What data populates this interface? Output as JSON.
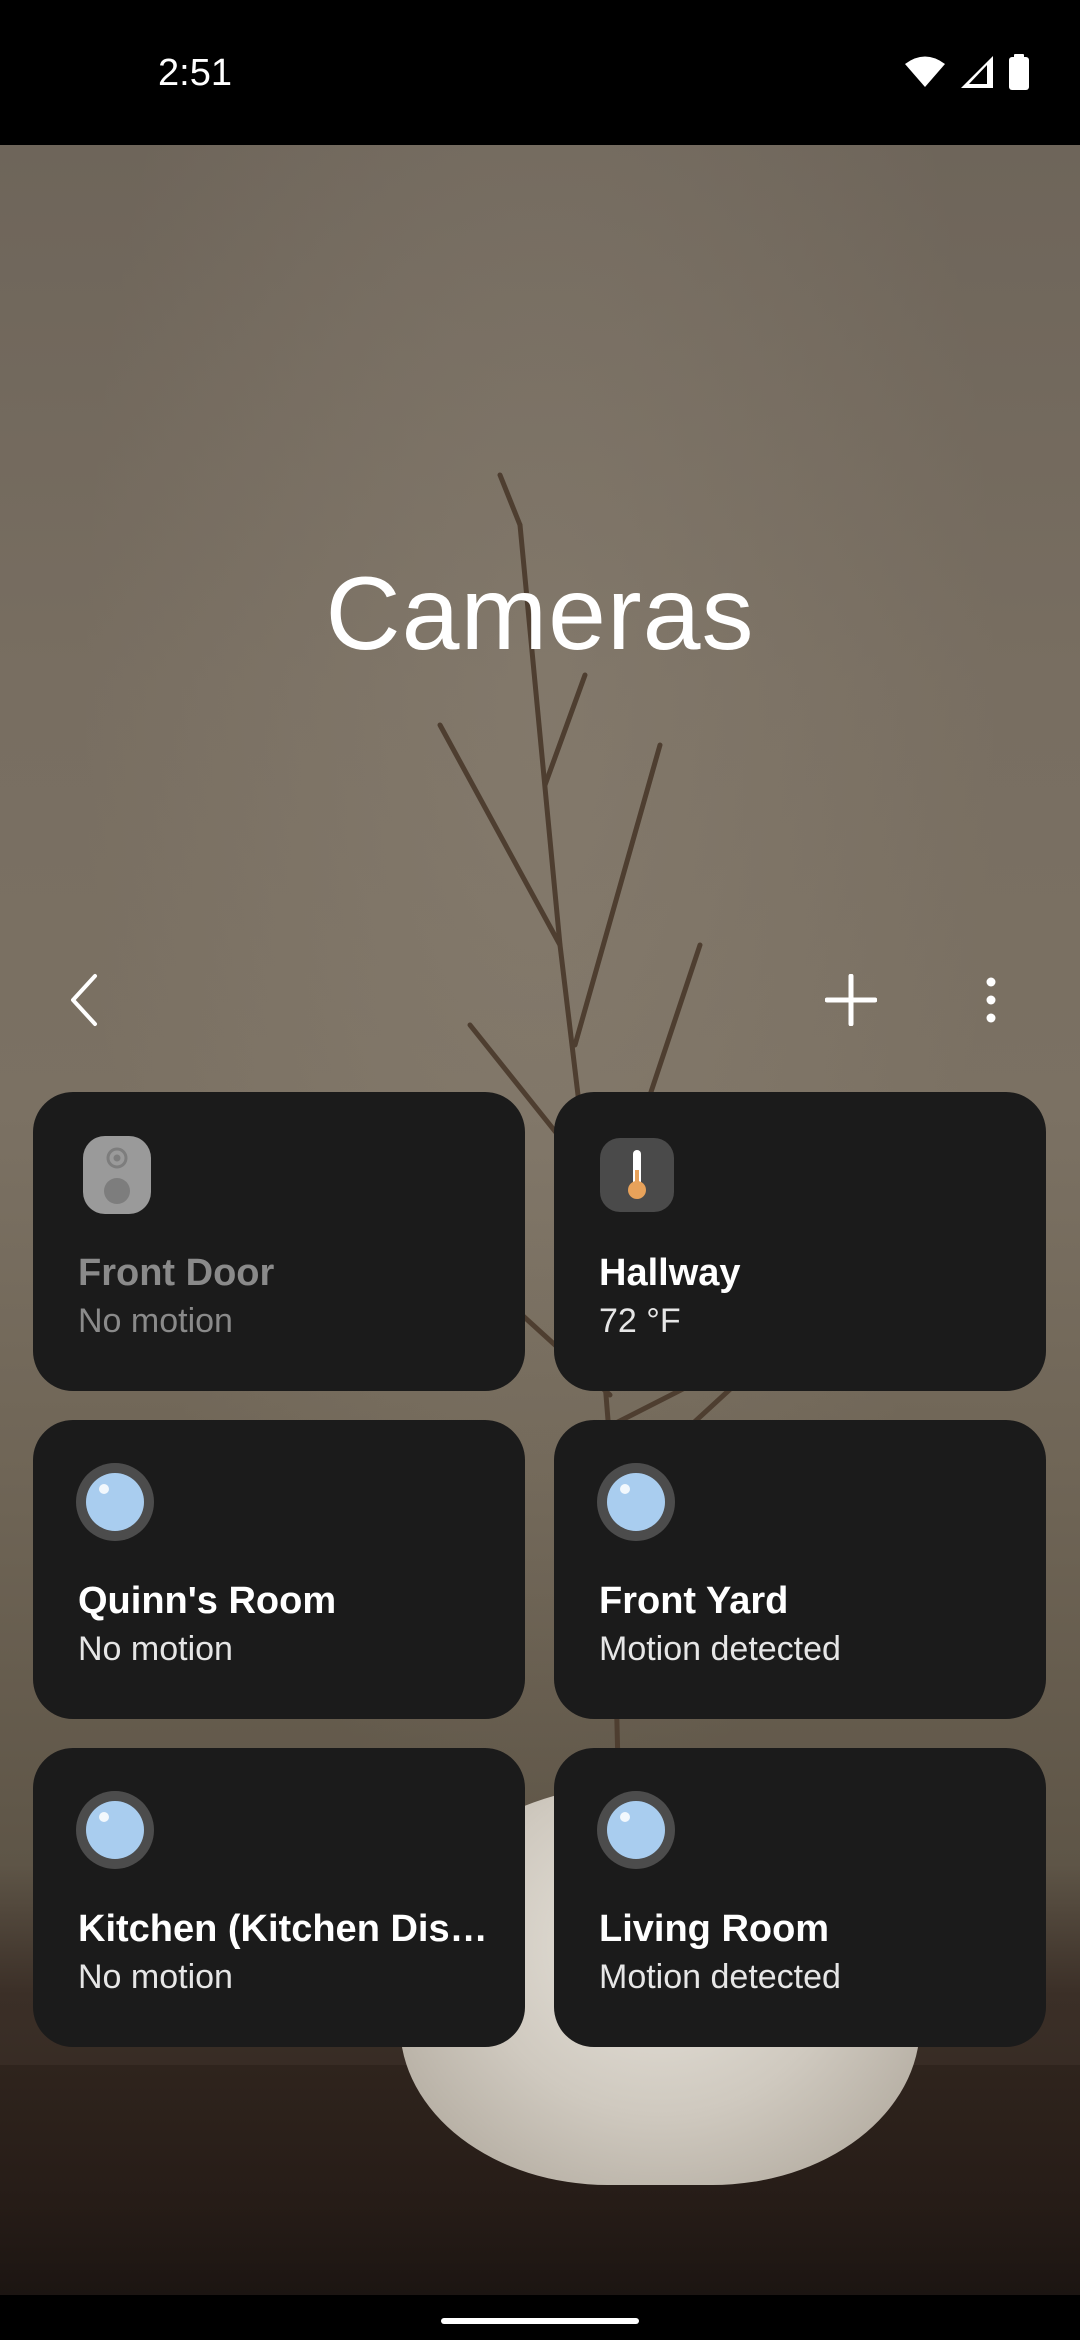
{
  "status_bar": {
    "time": "2:51"
  },
  "page": {
    "title": "Cameras"
  },
  "toolbar": {
    "back_icon": "chevron-left-icon",
    "add_icon": "plus-icon",
    "more_icon": "more-vertical-icon"
  },
  "devices": [
    {
      "name": "Front Door",
      "status": "No motion",
      "icon": "doorbell-icon",
      "dimmed": true
    },
    {
      "name": "Hallway",
      "status": "72 °F",
      "icon": "thermostat-icon",
      "dimmed": false
    },
    {
      "name": "Quinn's Room",
      "status": "No motion",
      "icon": "camera-lens-icon",
      "dimmed": false
    },
    {
      "name": "Front Yard",
      "status": "Motion detected",
      "icon": "camera-lens-icon",
      "dimmed": false
    },
    {
      "name": "Kitchen (Kitchen Display)",
      "status": "No motion",
      "icon": "camera-lens-icon",
      "dimmed": false
    },
    {
      "name": "Living Room",
      "status": "Motion detected",
      "icon": "camera-lens-icon",
      "dimmed": false
    }
  ],
  "colors": {
    "tile_bg": "#1b1b1b",
    "lens": "#a9cdef",
    "thermo_fill": "#e8a25a"
  }
}
